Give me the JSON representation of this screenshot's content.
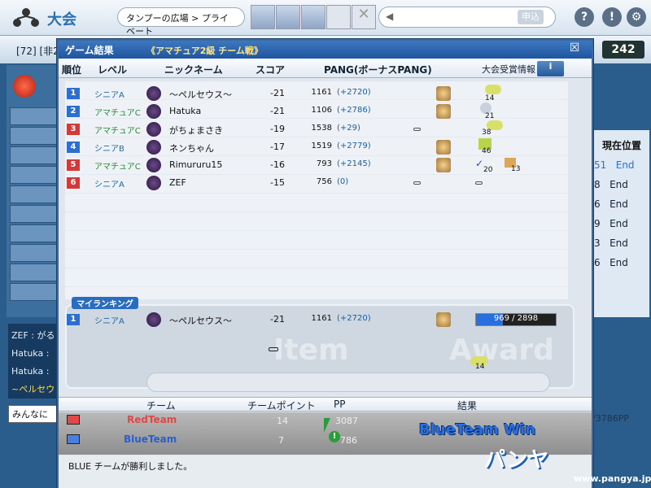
{
  "header": {
    "title": "大会",
    "breadcrumb": "タンプーの広場 > プライベート",
    "send_label": "申込"
  },
  "background": {
    "room_label": "[72] [非2",
    "score": "242",
    "right_head": "現在位置",
    "right_rows": [
      [
        "51",
        "End"
      ],
      [
        "8",
        "End"
      ],
      [
        "6",
        "End"
      ],
      [
        "9",
        "End"
      ],
      [
        "3",
        "End"
      ],
      [
        "6",
        "End"
      ]
    ],
    "chat_lines": [
      "ZEF : がる",
      "Hatuka :",
      "Hatuka :",
      "~ペルセウ"
    ],
    "chat_input": "みんなに",
    "right_pp": "/3786PP"
  },
  "window": {
    "title": "ゲーム結果",
    "subtitle": "《アマチュア2級 チーム戦》",
    "close": "☒"
  },
  "headers": {
    "rank": "順位",
    "level": "レベル",
    "nick": "ニックネーム",
    "score": "スコア",
    "pang": "PANG(ボーナスPANG)",
    "award": "大会受賞情報",
    "info": "i"
  },
  "players": [
    {
      "rank": "1",
      "level": "シニアA",
      "nick": "～ペルセウス～",
      "score": "-21",
      "pang": "1161",
      "bonus": "(+2720)",
      "rank_color": "#2c6fd0",
      "level_color": "#1d6aa5",
      "award": "14"
    },
    {
      "rank": "2",
      "level": "アマチュアC",
      "nick": "Hatuka",
      "score": "-21",
      "pang": "1106",
      "bonus": "(+2786)",
      "rank_color": "#2c6fd0",
      "level_color": "#2a8a3a",
      "award": "21"
    },
    {
      "rank": "3",
      "level": "アマチュアC",
      "nick": "がちょまさき",
      "score": "-19",
      "pang": "1538",
      "bonus": "(+29)",
      "rank_color": "#d23a3a",
      "level_color": "#2a8a3a",
      "award": "38"
    },
    {
      "rank": "4",
      "level": "シニアB",
      "nick": "ネンちゃん",
      "score": "-17",
      "pang": "1519",
      "bonus": "(+2779)",
      "rank_color": "#2c6fd0",
      "level_color": "#1d6aa5",
      "award": "46"
    },
    {
      "rank": "5",
      "level": "アマチュアC",
      "nick": "Rimururu15",
      "score": "-16",
      "pang": "793",
      "bonus": "(+2145)",
      "rank_color": "#d23a3a",
      "level_color": "#2a8a3a",
      "award": "20",
      "award2": "13"
    },
    {
      "rank": "6",
      "level": "シニアA",
      "nick": "ZEF",
      "score": "-15",
      "pang": "756",
      "bonus": "(0)",
      "rank_color": "#d23a3a",
      "level_color": "#1d6aa5",
      "award": ""
    }
  ],
  "my_ranking": {
    "tag": "マイランキング",
    "rank": "1",
    "level": "シニアA",
    "nick": "～ペルセウス～",
    "score": "-21",
    "pang": "1161",
    "bonus": "(+2720)",
    "progress_text": "969 / 2898",
    "progress": 0.334,
    "item_word": "Item",
    "award_word": "Award",
    "award_count": "14"
  },
  "team": {
    "headers": {
      "team": "チーム",
      "points": "チームポイント",
      "pp": "PP",
      "result": "結果"
    },
    "teams": [
      {
        "name": "RedTeam",
        "color": "#e04848",
        "points": "14",
        "pp": "3087"
      },
      {
        "name": "BlueTeam",
        "color": "#4a7fe0",
        "points": "7",
        "pp": "786"
      }
    ],
    "result": "BlueTeam Win"
  },
  "status": "BLUE チームが勝利しました。",
  "logo": "パンヤ",
  "site": "www.pangya.jp"
}
